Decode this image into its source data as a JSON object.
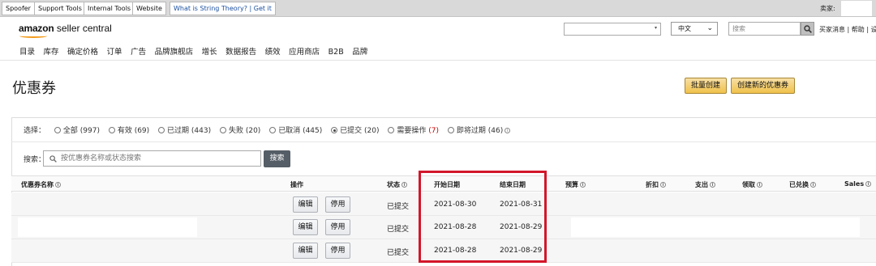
{
  "devbar": {
    "tabs": [
      "Spoofer",
      "Support Tools",
      "Internal Tools",
      "Website",
      "What is String Theory? | Get it"
    ],
    "seller_label": "卖家:"
  },
  "header": {
    "logo_text_bold": "amazon",
    "logo_text": " seller central",
    "language": "中文",
    "search_placeholder": "搜索",
    "links": "买家消息 | 帮助 | 设"
  },
  "nav": [
    "目录",
    "库存",
    "确定价格",
    "订单",
    "广告",
    "品牌旗舰店",
    "增长",
    "数据报告",
    "绩效",
    "应用商店",
    "B2B",
    "品牌"
  ],
  "page": {
    "title": "优惠券",
    "bulk_create": "批量创建",
    "create_new": "创建新的优惠券"
  },
  "filter": {
    "label": "选择：",
    "options": [
      {
        "label": "全部 (997)",
        "selected": false
      },
      {
        "label": "有效 (69)",
        "selected": false
      },
      {
        "label": "已过期 (443)",
        "selected": false
      },
      {
        "label": "失败 (20)",
        "selected": false
      },
      {
        "label": "已取消 (445)",
        "selected": false
      },
      {
        "label": "已提交 (20)",
        "selected": true
      },
      {
        "label": "需要操作",
        "count": "(7)",
        "selected": false
      },
      {
        "label": "即将过期 (46)",
        "selected": false
      }
    ]
  },
  "search": {
    "label": "搜索：",
    "placeholder": "按优惠券名称或状态搜索",
    "button": "搜索"
  },
  "table": {
    "headers": {
      "name": "优惠券名称",
      "actions": "操作",
      "status": "状态",
      "start": "开始日期",
      "end": "结束日期",
      "budget": "预算",
      "discount": "折扣",
      "spend": "支出",
      "clipped": "领取",
      "redeemed": "已兑换",
      "sales": "Sales"
    },
    "edit_label": "编辑",
    "deactivate_label": "停用",
    "rows": [
      {
        "status": "已提交",
        "start": "2021-08-30",
        "end": "2021-08-31"
      },
      {
        "status": "已提交",
        "start": "2021-08-28",
        "end": "2021-08-29"
      },
      {
        "status": "已提交",
        "start": "2021-08-28",
        "end": "2021-08-29"
      }
    ]
  },
  "colors": {
    "highlight": "#d3162a",
    "primary_button": "#f0c14b",
    "search_button": "#555d66"
  }
}
